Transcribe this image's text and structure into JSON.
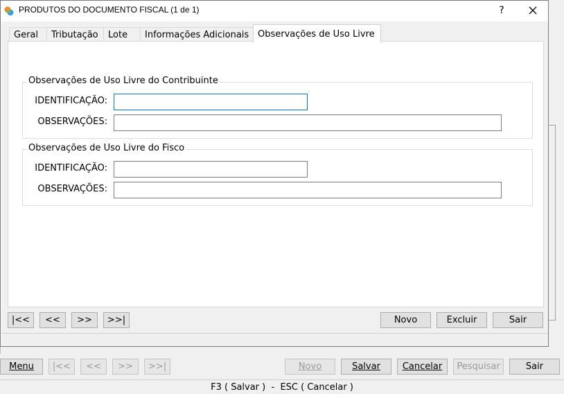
{
  "window": {
    "title": "PRODUTOS DO DOCUMENTO FISCAL (1 de 1)",
    "help_glyph": "?",
    "close_glyph": "✕"
  },
  "tabs": [
    {
      "label": "Geral",
      "active": false
    },
    {
      "label": "Tributação",
      "active": false
    },
    {
      "label": "Lote",
      "active": false
    },
    {
      "label": "Informações Adicionais",
      "active": false
    },
    {
      "label": "Observações de Uso Livre",
      "active": true
    }
  ],
  "contribuinte": {
    "title": "Observações de Uso Livre do Contribuinte",
    "identificacao_label": "IDENTIFICAÇÃO:",
    "identificacao_value": "",
    "observacoes_label": "OBSERVAÇÕES:",
    "observacoes_value": ""
  },
  "fisco": {
    "title": "Observações de Uso Livre do Fisco",
    "identificacao_label": "IDENTIFICAÇÃO:",
    "identificacao_value": "",
    "observacoes_label": "OBSERVAÇÕES:",
    "observacoes_value": ""
  },
  "dialog_nav": {
    "first": "|<<",
    "prev": "<<",
    "next": ">>",
    "last": ">>|"
  },
  "dialog_actions": {
    "novo": "Novo",
    "excluir": "Excluir",
    "sair": "Sair"
  },
  "main_toolbar": {
    "menu": "Menu",
    "first": "|<<",
    "prev": "<<",
    "next": ">>",
    "last": ">>|",
    "novo": "Novo",
    "salvar": "Salvar",
    "cancelar": "Cancelar",
    "pesquisar": "Pesquisar",
    "sair": "Sair"
  },
  "statusbar": {
    "text": "F3 ( Salvar )  -  ESC ( Cancelar )"
  },
  "colors": {
    "focus_border": "#0078d7",
    "button_face": "#e1e1e1",
    "window_bg": "#f0f0f0"
  }
}
